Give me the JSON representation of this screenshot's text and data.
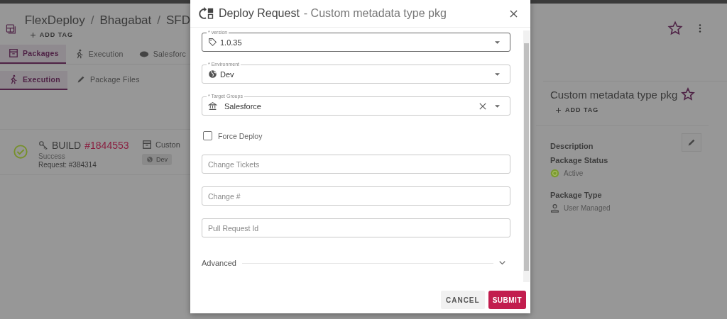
{
  "header": {
    "breadcrumb": [
      {
        "kind": "link",
        "text": "FlexDeploy"
      },
      {
        "kind": "separator",
        "text": "/"
      },
      {
        "kind": "link",
        "text": "Bhagabat"
      },
      {
        "kind": "separator",
        "text": "/"
      },
      {
        "kind": "link",
        "text": "SFD"
      }
    ],
    "add_tag": "ADD TAG"
  },
  "tabs": [
    {
      "label": "Packages",
      "selected": true
    },
    {
      "label": "Execution",
      "selected": false
    },
    {
      "label": "Salesforc",
      "selected": false
    }
  ],
  "subtabs": [
    {
      "label": "Execution",
      "selected": true
    },
    {
      "label": "Package Files",
      "selected": false
    }
  ],
  "execution": {
    "title": "BUILD",
    "number": "#1844553",
    "status": "Success",
    "request": "Request: #384314",
    "package": "Custon",
    "environment": "Dev"
  },
  "details": {
    "title": "Custom metadata type pkg",
    "add_tag": "ADD TAG",
    "description_label": "Description",
    "status_label": "Package Status",
    "status": "Active",
    "type_label": "Package Type",
    "type": "User Managed"
  },
  "dialog": {
    "title": "Deploy Request",
    "subtitle": "- Custom metadata type pkg",
    "selects": [
      {
        "label": "* version",
        "value": "1.0.35",
        "focused": true,
        "clearable": false
      },
      {
        "label": "* Environment",
        "value": "Dev",
        "focused": false,
        "clearable": false
      },
      {
        "label": "* Target Groups",
        "value": "Salesforce",
        "focused": false,
        "clearable": true
      }
    ],
    "force_deploy": {
      "label": "Force Deploy",
      "checked": false
    },
    "inputs": [
      {
        "placeholder": "Change Tickets"
      },
      {
        "placeholder": "Change #"
      },
      {
        "placeholder": "Pull Request Id"
      }
    ],
    "advanced": {
      "label": "Advanced",
      "expanded": false
    },
    "buttons": {
      "cancel": "CANCEL",
      "submit": "SUBMIT"
    }
  }
}
